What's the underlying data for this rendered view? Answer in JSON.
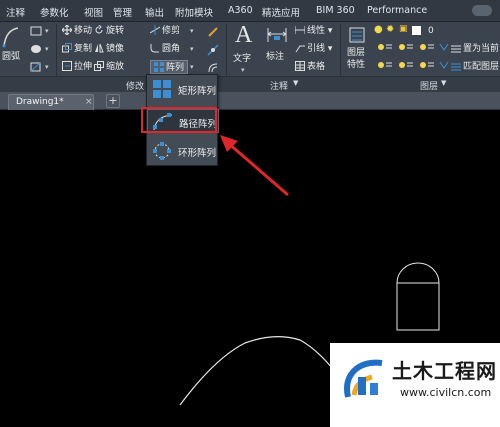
{
  "menu_tabs": [
    "注释",
    "参数化",
    "视图",
    "管理",
    "输出",
    "附加模块",
    "A360",
    "精选应用",
    "BIM 360",
    "Performance"
  ],
  "ribbon": {
    "arc_label": "圆弧",
    "modify": {
      "col1": [
        "移动",
        "复制",
        "拉伸"
      ],
      "col2": [
        "旋转",
        "镜像",
        "缩放"
      ],
      "col3": [
        "修剪",
        "圆角",
        "阵列"
      ]
    },
    "text_label": "文字",
    "dim_label": "标注",
    "linear_label": "线性",
    "leader_label": "引线",
    "table_label": "表格",
    "layer_props": [
      "图层",
      "特性"
    ],
    "layer_zero": "0",
    "layer_current": "置为当前",
    "layer_match": "匹配图层",
    "panel_modify": "修改",
    "panel_annotation": "注释",
    "panel_layers": "图层"
  },
  "document": {
    "tab_name": "Drawing1*",
    "close_glyph": "×",
    "new_tab_glyph": "+"
  },
  "array_dropdown": {
    "items": [
      "矩形阵列",
      "路径阵列",
      "环形阵列"
    ],
    "highlighted": "路径阵列"
  },
  "watermark": {
    "title": "土木工程网",
    "url": "www.civilcn.com"
  },
  "colors": {
    "highlight": "#e0262b",
    "canvas": "#000000",
    "ribbon": "#3b444e",
    "accent_blue": "#3a8fd6"
  }
}
